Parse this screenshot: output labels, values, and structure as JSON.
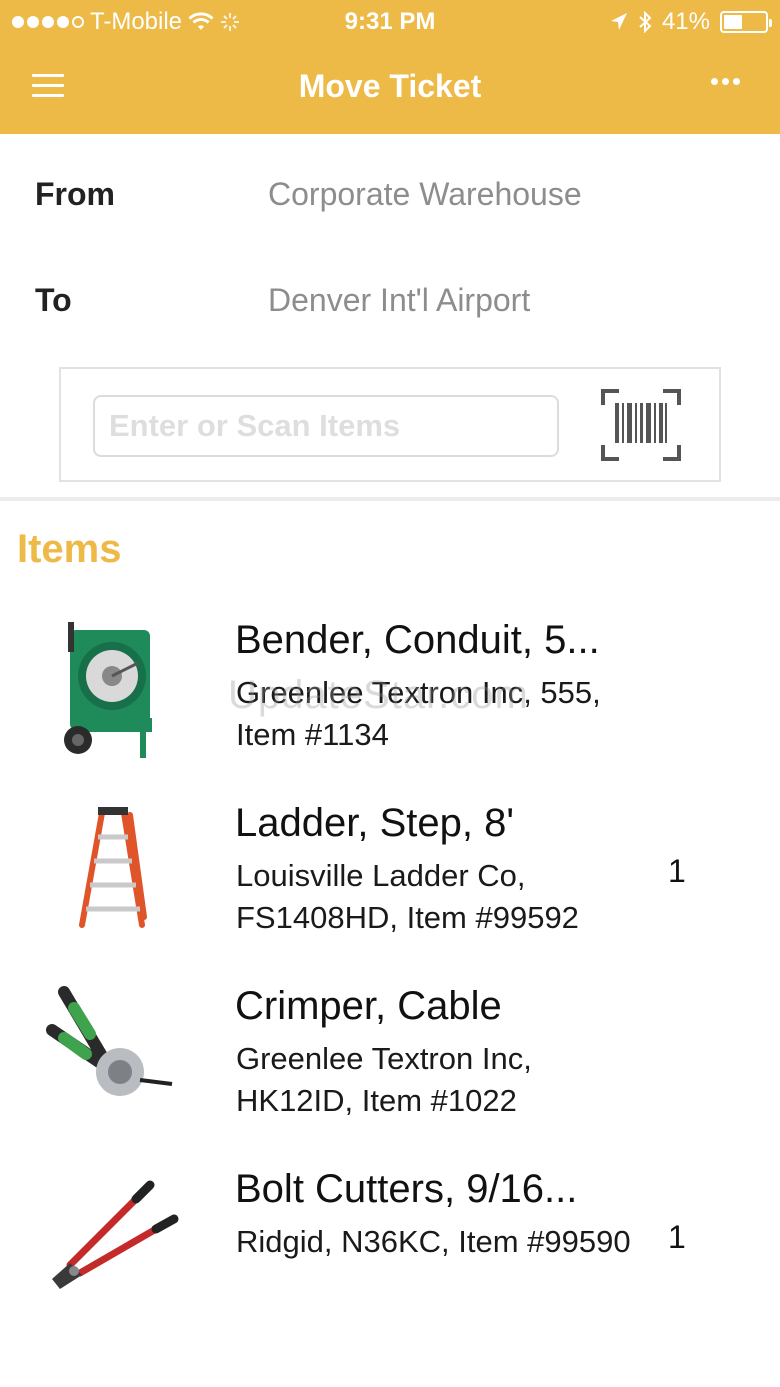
{
  "status_bar": {
    "carrier": "T-Mobile",
    "time": "9:31 PM",
    "battery_percent": "41%",
    "battery_level": 0.41,
    "signal_bars_filled": 4
  },
  "nav": {
    "title": "Move Ticket",
    "menu_icon": "hamburger-menu-icon",
    "more_icon": "more-options-icon"
  },
  "ticket": {
    "from_label": "From",
    "from_value": "Corporate Warehouse",
    "to_label": "To",
    "to_value": "Denver Int'l Airport"
  },
  "scan": {
    "placeholder": "Enter or Scan Items",
    "button_icon": "barcode-scan-icon"
  },
  "items_section": {
    "title": "Items",
    "items": [
      {
        "name": "Bender, Conduit, 5...",
        "sub": "Greenlee Textron Inc, 555, Item #1134",
        "qty": "",
        "icon": "conduit-bender-image"
      },
      {
        "name": "Ladder, Step, 8'",
        "sub": "Louisville Ladder Co, FS1408HD, Item #99592",
        "qty": "1",
        "icon": "step-ladder-image"
      },
      {
        "name": "Crimper, Cable",
        "sub": "Greenlee Textron Inc, HK12ID, Item #1022",
        "qty": "",
        "icon": "cable-crimper-image"
      },
      {
        "name": "Bolt Cutters, 9/16...",
        "sub": "Ridgid, N36KC, Item #99590",
        "qty": "1",
        "icon": "bolt-cutters-image"
      }
    ]
  },
  "watermark": "UpdateStar.com",
  "colors": {
    "accent": "#EDBA47",
    "muted_text": "#8d8d8d"
  }
}
